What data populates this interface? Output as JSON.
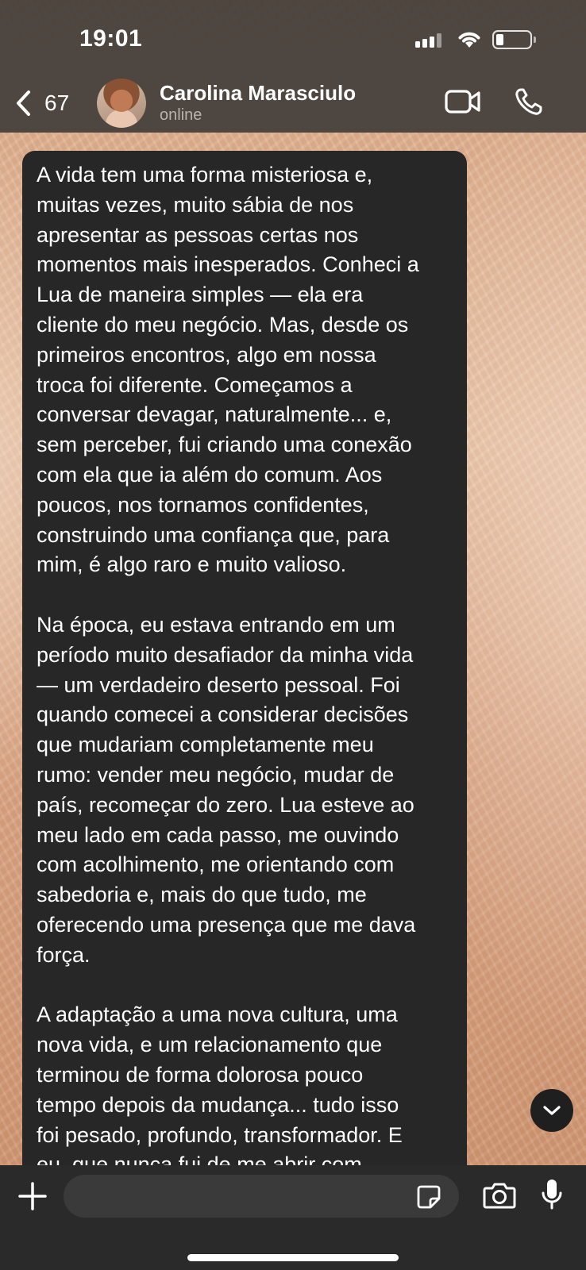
{
  "status_bar": {
    "time": "19:01"
  },
  "header": {
    "back_count": "67",
    "contact_name": "Carolina Marasciulo",
    "contact_status": "online",
    "icons": [
      "chevron-left-icon",
      "video-call-icon",
      "phone-icon"
    ]
  },
  "message": {
    "text": "A vida tem uma forma misteriosa e,\nmuitas vezes, muito sábia de nos\napresentar as pessoas certas nos\nmomentos mais inesperados. Conheci a\nLua de maneira simples — ela era\ncliente do meu negócio. Mas, desde os\nprimeiros encontros, algo em nossa\ntroca foi diferente. Começamos a\nconversar devagar, naturalmente... e,\nsem perceber, fui criando uma conexão\ncom ela que ia além do comum. Aos\npoucos, nos tornamos confidentes,\nconstruindo uma confiança que, para\nmim, é algo raro e muito valioso.\n\nNa época, eu estava entrando em um\nperíodo muito desafiador da minha vida\n— um verdadeiro deserto pessoal. Foi\nquando comecei a considerar decisões\nque mudariam completamente meu\nrumo: vender meu negócio, mudar de\npaís, recomeçar do zero. Lua esteve ao\nmeu lado em cada passo, me ouvindo\ncom acolhimento, me orientando com\nsabedoria e, mais do que tudo, me\noferecendo uma presença que me dava\nforça.\n\nA adaptação a uma nova cultura, uma\nnova vida, e um relacionamento que\nterminou de forma dolorosa pouco\ntempo depois da mudança... tudo isso\nfoi pesado, profundo, transformador. E\neu, que nunca fui de me abrir com"
  },
  "composer": {
    "input_value": "",
    "icons": [
      "plus-icon",
      "sticker-icon",
      "camera-icon",
      "microphone-icon"
    ]
  },
  "colors": {
    "header_bg": "#48423c",
    "bubble_bg": "#272727",
    "bottom_bar_bg": "#2a2a2a",
    "input_bg": "#3a3a3a"
  }
}
